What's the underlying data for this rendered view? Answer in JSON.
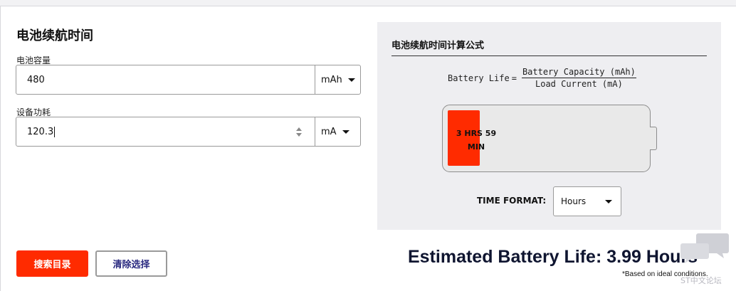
{
  "form": {
    "title": "电池续航时间",
    "capacity": {
      "label": "电池容量",
      "value": "480",
      "unit": "mAh"
    },
    "power": {
      "label": "设备功耗",
      "value": "120.3",
      "unit": "mA"
    },
    "search_label": "搜索目录",
    "clear_label": "清除选择"
  },
  "panel": {
    "title": "电池续航时间计算公式",
    "formula": {
      "lhs": "Battery Life",
      "eq": "=",
      "numerator": "Battery Capacity (mAh)",
      "denominator": "Load Current (mA)"
    },
    "battery": {
      "fill_fraction": 0.1627,
      "line1": "3 HRS 59",
      "line2": "MIN"
    },
    "time_format": {
      "label": "TIME FORMAT:",
      "value": "Hours"
    }
  },
  "result": {
    "text": "Estimated Battery Life: 3.99 Hours",
    "note": "*Based on ideal conditions."
  },
  "watermark": {
    "icon": "chat-bubbles-icon",
    "text": "ST中文论坛"
  },
  "colors": {
    "accent": "#ff2b00",
    "result_text": "#0f1530",
    "panel_bg": "#eeeef1"
  }
}
